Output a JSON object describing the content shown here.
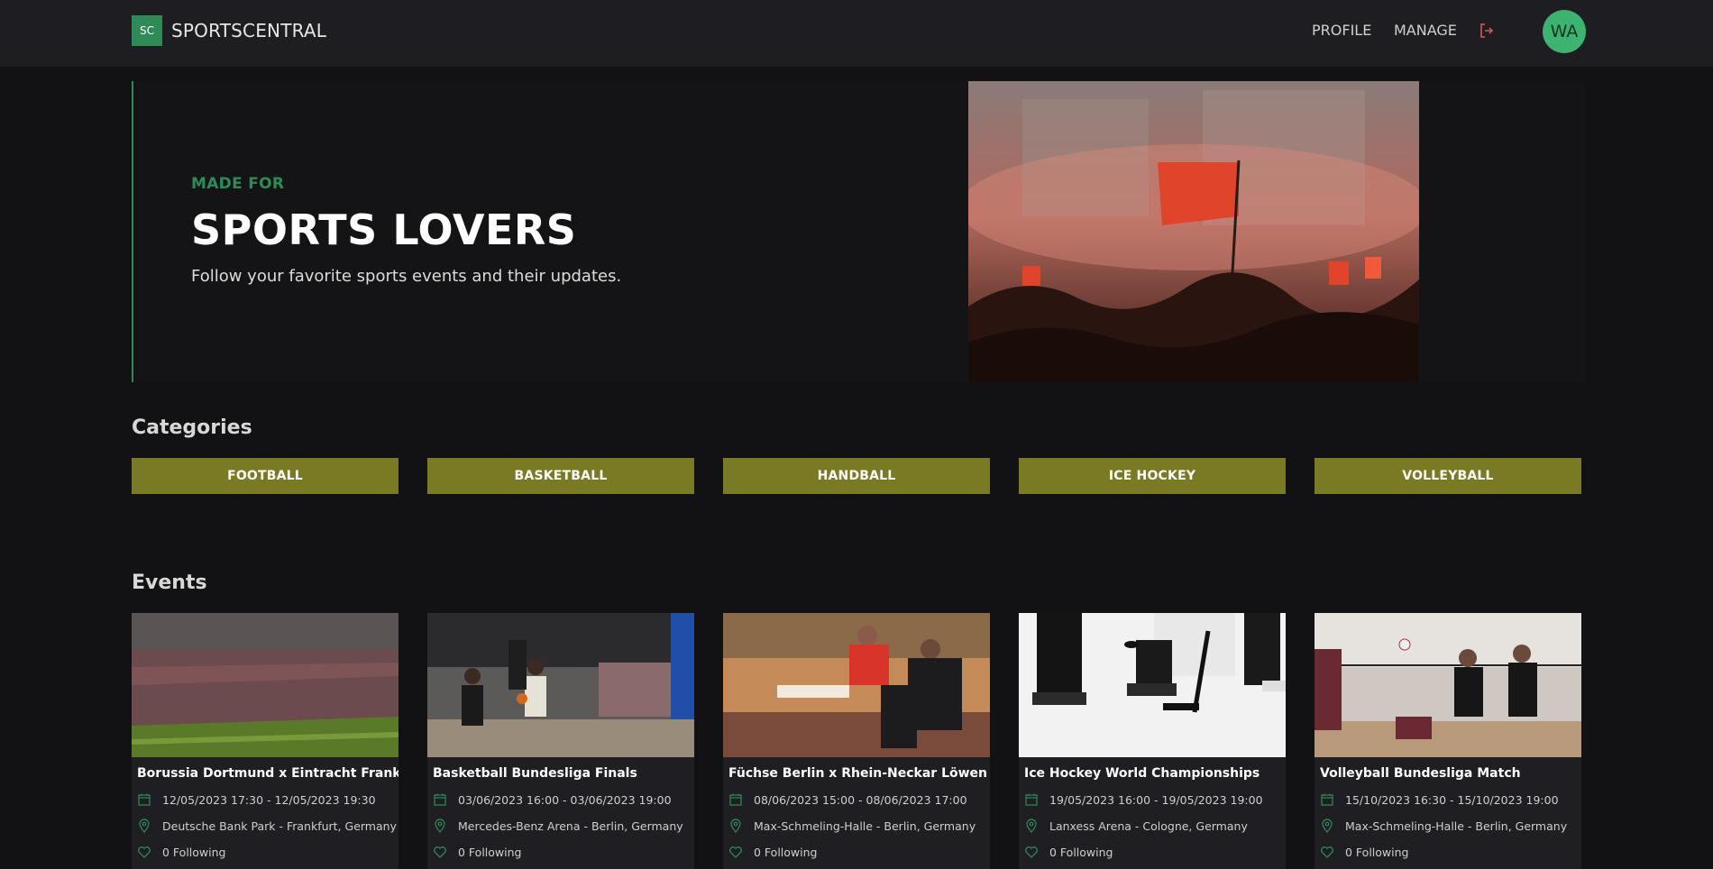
{
  "brand": {
    "badge": "SC",
    "name": "SPORTSCENTRAL"
  },
  "nav": {
    "profile": "PROFILE",
    "manage": "MANAGE",
    "avatar_initials": "WA",
    "logout_icon": "logout-icon"
  },
  "hero": {
    "kicker": "MADE FOR",
    "title": "SPORTS LOVERS",
    "subtitle": "Follow your favorite sports events and their updates."
  },
  "categories": {
    "heading": "Categories",
    "items": [
      "FOOTBALL",
      "BASKETBALL",
      "HANDBALL",
      "ICE HOCKEY",
      "VOLLEYBALL"
    ]
  },
  "events": {
    "heading": "Events",
    "items": [
      {
        "title": "Borussia Dortmund x Eintracht Frankfurt",
        "dates": "12/05/2023 17:30 - 12/05/2023 19:30",
        "venue": "Deutsche Bank Park - Frankfurt, Germany",
        "following": "0 Following"
      },
      {
        "title": "Basketball Bundesliga Finals",
        "dates": "03/06/2023 16:00 - 03/06/2023 19:00",
        "venue": "Mercedes-Benz Arena - Berlin, Germany",
        "following": "0 Following"
      },
      {
        "title": "Füchse Berlin x Rhein-Neckar Löwen",
        "dates": "08/06/2023 15:00 - 08/06/2023 17:00",
        "venue": "Max-Schmeling-Halle - Berlin, Germany",
        "following": "0 Following"
      },
      {
        "title": "Ice Hockey World Championships",
        "dates": "19/05/2023 16:00 - 19/05/2023 19:00",
        "venue": "Lanxess Arena - Cologne, Germany",
        "following": "0 Following"
      },
      {
        "title": "Volleyball Bundesliga Match",
        "dates": "15/10/2023 16:30 - 15/10/2023 19:00",
        "venue": "Max-Schmeling-Halle - Berlin, Germany",
        "following": "0 Following"
      }
    ]
  },
  "colors": {
    "accent": "#2e8b57",
    "category_button": "#7a7a24",
    "logout": "#e05a5a"
  }
}
